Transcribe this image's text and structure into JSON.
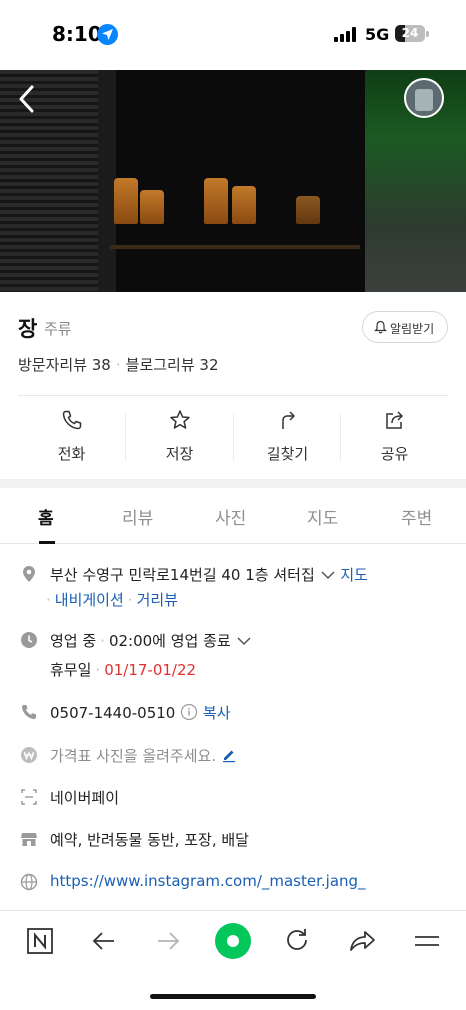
{
  "status_bar": {
    "time": "8:10",
    "network": "5G",
    "battery": "24"
  },
  "place": {
    "name": "장",
    "category": "주류",
    "notify_label": "알림받기",
    "visitor_reviews": "방문자리뷰 38",
    "blog_reviews": "블로그리뷰 32"
  },
  "actions": [
    {
      "label": "전화",
      "icon": "phone-icon"
    },
    {
      "label": "저장",
      "icon": "star-icon"
    },
    {
      "label": "길찾기",
      "icon": "directions-icon"
    },
    {
      "label": "공유",
      "icon": "share-icon"
    }
  ],
  "tabs": [
    {
      "label": "홈",
      "active": true
    },
    {
      "label": "리뷰",
      "active": false
    },
    {
      "label": "사진",
      "active": false
    },
    {
      "label": "지도",
      "active": false
    },
    {
      "label": "주변",
      "active": false
    }
  ],
  "info": {
    "address": "부산 수영구 민락로14번길 40 1층 셔터집",
    "address_map_link": "지도",
    "address_navi_link": "내비게이션",
    "address_street_link": "거리뷰",
    "hours_status": "영업 중",
    "hours_detail": "02:00에 영업 종료",
    "holiday_label": "휴무일",
    "holiday_dates": "01/17-01/22",
    "phone": "0507-1440-0510",
    "phone_copy": "복사",
    "price_prompt": "가격표 사진을 올려주세요.",
    "payment": "네이버페이",
    "amenities": "예약, 반려동물 동반, 포장, 배달",
    "website": "https://www.instagram.com/_master.jang_"
  },
  "colors": {
    "accent_green": "#03c75a",
    "link_blue": "#1a5fb4",
    "holiday_red": "#e03131"
  }
}
